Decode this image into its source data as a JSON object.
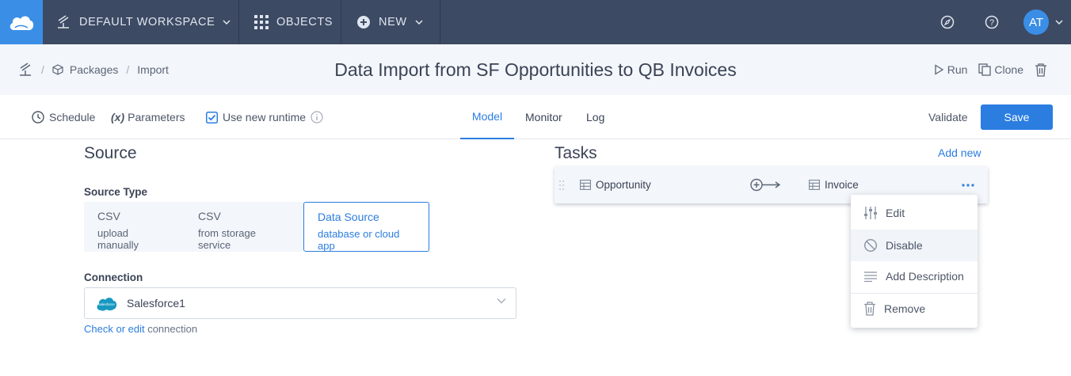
{
  "topbar": {
    "workspace_label": "DEFAULT WORKSPACE",
    "objects_label": "OBJECTS",
    "new_label": "NEW",
    "avatar_initials": "AT"
  },
  "breadcrumb": {
    "packages": "Packages",
    "import": "Import"
  },
  "page_title": "Data Import from SF Opportunities to QB Invoices",
  "header_actions": {
    "run": "Run",
    "clone": "Clone"
  },
  "toolbar": {
    "schedule": "Schedule",
    "parameters_prefix": "(x)",
    "parameters": "Parameters",
    "use_new_runtime": "Use new runtime",
    "tabs": [
      "Model",
      "Monitor",
      "Log"
    ],
    "active_tab": "Model",
    "validate": "Validate",
    "save": "Save"
  },
  "source": {
    "heading": "Source",
    "source_type_label": "Source Type",
    "options": [
      {
        "title": "CSV",
        "subtitle": "upload manually",
        "selected": false
      },
      {
        "title": "CSV",
        "subtitle": "from storage service",
        "selected": false
      },
      {
        "title": "Data Source",
        "subtitle": "database or cloud app",
        "selected": true
      }
    ],
    "connection_label": "Connection",
    "connection_value": "Salesforce1",
    "connection_logo_text": "salesforce",
    "check_link": "Check or edit",
    "check_suffix": " connection"
  },
  "tasks": {
    "heading": "Tasks",
    "add_new": "Add new",
    "row": {
      "source": "Opportunity",
      "target": "Invoice"
    },
    "menu": [
      "Edit",
      "Disable",
      "Add Description",
      "Remove"
    ],
    "menu_highlighted": "Disable"
  },
  "colors": {
    "topbar": "#3d4a63",
    "accent": "#2b7de0",
    "header_bg": "#f3f6fa"
  }
}
